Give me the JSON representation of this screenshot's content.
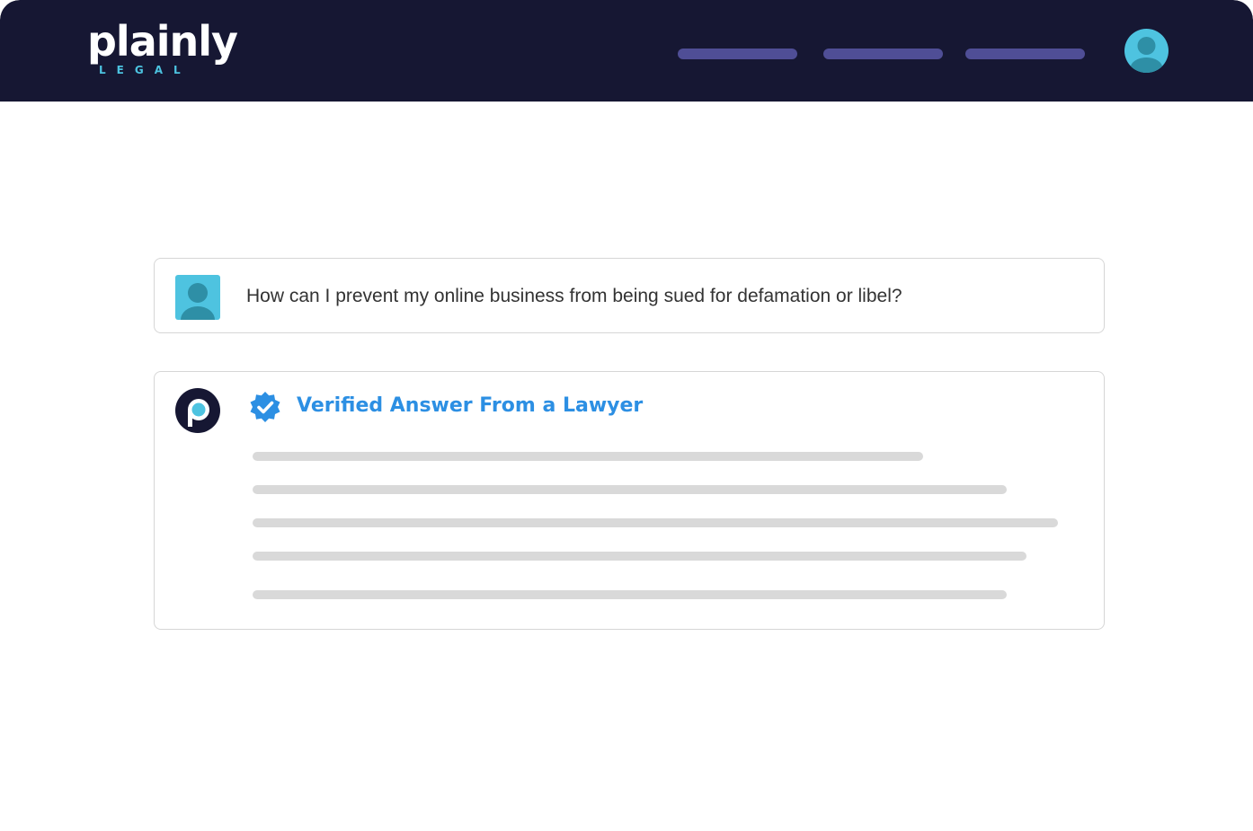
{
  "header": {
    "logo": {
      "word": "plainly",
      "sub": "LEGAL",
      "icon": "plainly-legal-logo"
    },
    "nav_items": [
      {
        "icon": "nav-placeholder-pill"
      },
      {
        "icon": "nav-placeholder-pill"
      },
      {
        "icon": "nav-placeholder-pill"
      }
    ],
    "profile_icon": "user-avatar-icon"
  },
  "conversation": {
    "question": {
      "avatar_icon": "user-avatar-icon",
      "text": "How can I prevent my online business from being sued for defamation or libel?"
    },
    "answer": {
      "avatar_icon": "plainly-p-logo",
      "badge_icon": "verified-check-icon",
      "title": "Verified Answer From a Lawyer",
      "placeholder_line_count": 5
    }
  },
  "colors": {
    "header_bg": "#161733",
    "nav_pill": "#4f4e96",
    "accent_cyan": "#4ec3e0",
    "verified_blue": "#2c8fe3",
    "skeleton_gray": "#d9d9d9",
    "card_border": "#d6d6d6"
  }
}
